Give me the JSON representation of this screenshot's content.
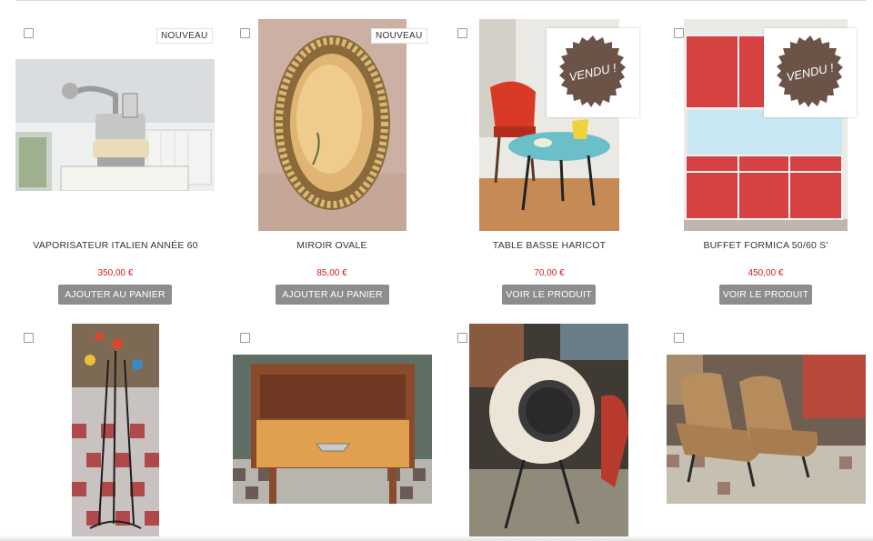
{
  "badges": {
    "new": "NOUVEAU",
    "sold": "VENDU !"
  },
  "colors": {
    "price": "#cc1b1b",
    "button": "#8d8d8d",
    "sold_seal": "#6b5348"
  },
  "products": [
    {
      "title": "VAPORISATEUR ITALIEN ANNÉE 60",
      "price": "350,00 €",
      "button": "AJOUTER AU PANIER",
      "status": "new"
    },
    {
      "title": "MIROIR OVALE",
      "price": "85,00 €",
      "button": "AJOUTER AU PANIER",
      "status": "new"
    },
    {
      "title": "TABLE BASSE HARICOT",
      "price": "70,00 €",
      "button": "VOIR LE PRODUIT",
      "status": "sold"
    },
    {
      "title": "BUFFET FORMICA 50/60 S'",
      "price": "450,00 €",
      "button": "VOIR LE PRODUIT",
      "status": "sold"
    },
    {
      "image": "coat-rack-image"
    },
    {
      "image": "bedside-table-image"
    },
    {
      "image": "ball-speaker-image"
    },
    {
      "image": "armchairs-image"
    }
  ]
}
